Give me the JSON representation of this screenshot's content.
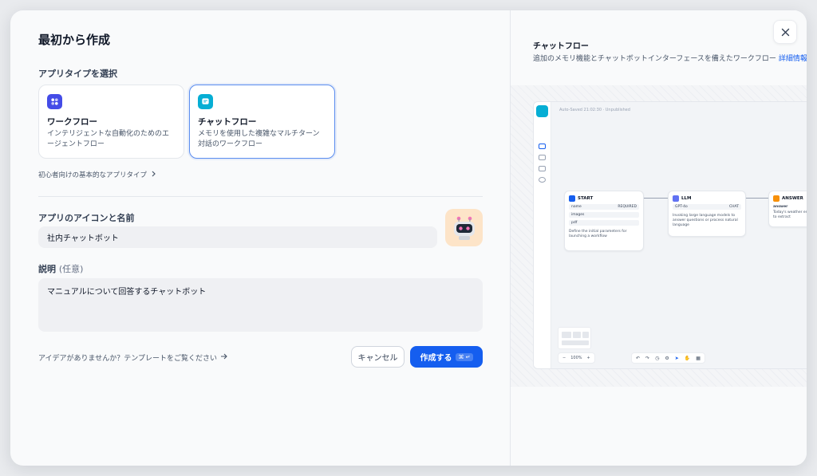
{
  "modal": {
    "title": "最初から作成",
    "app_type_label": "アプリタイプを選択",
    "app_types": [
      {
        "title": "ワークフロー",
        "desc": "インテリジェントな自動化のためのエージェントフロー",
        "icon": "workflow-icon",
        "color": "#444ce7",
        "selected": false
      },
      {
        "title": "チャットフロー",
        "desc": "メモリを使用した複雑なマルチターン対話のワークフロー",
        "icon": "chatflow-icon",
        "color": "#06aed4",
        "selected": true
      }
    ],
    "beginner_link": "初心者向けの基本的なアプリタイプ",
    "name_label": "アプリのアイコンと名前",
    "name_value": "社内チャットボット",
    "desc_label": "説明",
    "desc_optional": "(任意)",
    "desc_value": "マニュアルについて回答するチャットボット",
    "idea_link": "アイデアがありませんか？テンプレートをご覧ください",
    "cancel_label": "キャンセル",
    "create_label": "作成する",
    "create_shortcut": "⌘ ↵"
  },
  "preview": {
    "title": "チャットフロー",
    "desc": "追加のメモリ機能とチャットボットインターフェースを備えたワークフロー",
    "link": "詳細情報",
    "canvas_header": "Auto-Saved 21:02:30 · Unpublished",
    "nodes": {
      "start": {
        "title": "START",
        "vars": [
          {
            "name": "name",
            "tag": "REQUIRED"
          },
          {
            "name": "images",
            "tag": ""
          },
          {
            "name": "pdf",
            "tag": ""
          }
        ],
        "desc": "Define the initial parameters for launching a workflow"
      },
      "llm": {
        "title": "LLM",
        "model": "GPT-4o",
        "model_tag": "CHAT",
        "desc": "Invoking large language models to answer questions or process natural language"
      },
      "answer": {
        "title": "ANSWER",
        "field": "answer",
        "desc": "Today's weather entities to extract"
      }
    },
    "zoom": "100%"
  },
  "colors": {
    "accent": "#155eef",
    "workflow": "#444ce7",
    "chatflow": "#06aed4",
    "answer": "#f79009",
    "llm": "#6172f3"
  }
}
